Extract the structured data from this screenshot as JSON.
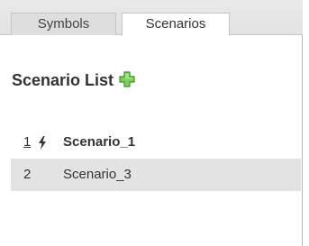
{
  "tabs": [
    {
      "label": "Symbols",
      "active": false
    },
    {
      "label": "Scenarios",
      "active": true
    }
  ],
  "panel": {
    "title": "Scenario List",
    "add_icon": "plus-icon",
    "add_icon_color": "#6cc24a"
  },
  "scenarios": [
    {
      "number": "1",
      "name": "Scenario_1",
      "active": true,
      "icon": "lightning-bolt-icon"
    },
    {
      "number": "2",
      "name": "Scenario_3",
      "active": false
    }
  ],
  "colors": {
    "tabbar_bg": "#e5e5e5",
    "selected_row_bg": "#e3e3e3",
    "text": "#333333"
  }
}
